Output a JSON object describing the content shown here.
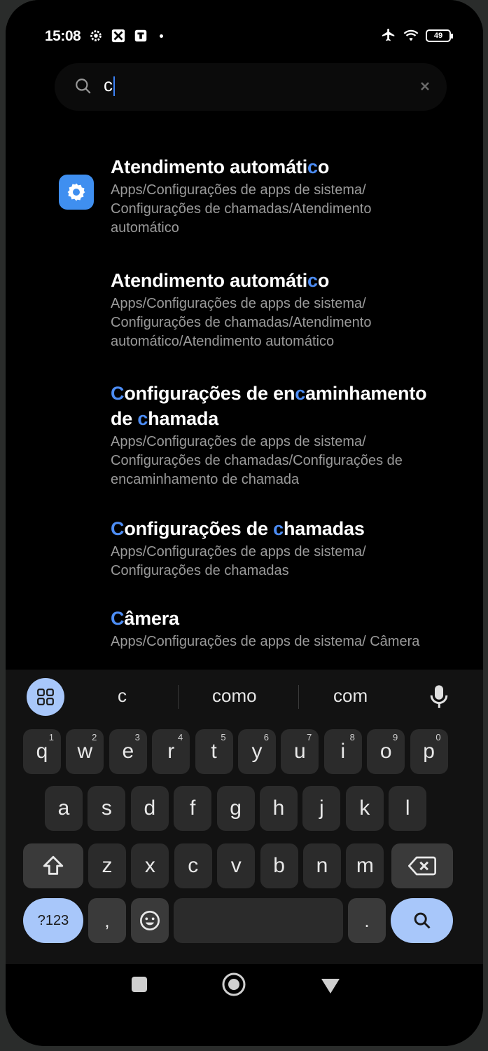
{
  "status_bar": {
    "time": "15:08",
    "battery": "49"
  },
  "search": {
    "query": "c"
  },
  "results": [
    {
      "title_parts": [
        "Atendimento automáti",
        "c",
        "o"
      ],
      "path": "Apps/Configurações de apps de sistema/ Configurações de chamadas/Atendimento automático"
    },
    {
      "title_parts": [
        "Atendimento automáti",
        "c",
        "o"
      ],
      "path": "Apps/Configurações de apps de sistema/ Configurações de chamadas/Atendimento automático/Atendimento automático"
    },
    {
      "title_parts": [
        "C",
        "onfigurações de en",
        "c",
        "aminhamento de ",
        "c",
        "hamada"
      ],
      "path": "Apps/Configurações de apps de sistema/ Configurações de chamadas/Configurações de encaminhamento de chamada"
    },
    {
      "title_parts": [
        "C",
        "onfigurações de ",
        "c",
        "hamadas"
      ],
      "path": "Apps/Configurações de apps de sistema/ Configurações de chamadas"
    },
    {
      "title_parts": [
        "C",
        "âmera"
      ],
      "path": "Apps/Configurações de apps de sistema/ Câmera"
    }
  ],
  "keyboard": {
    "suggestions": [
      "c",
      "como",
      "com"
    ],
    "row1": [
      {
        "k": "q",
        "n": "1"
      },
      {
        "k": "w",
        "n": "2"
      },
      {
        "k": "e",
        "n": "3"
      },
      {
        "k": "r",
        "n": "4"
      },
      {
        "k": "t",
        "n": "5"
      },
      {
        "k": "y",
        "n": "6"
      },
      {
        "k": "u",
        "n": "7"
      },
      {
        "k": "i",
        "n": "8"
      },
      {
        "k": "o",
        "n": "9"
      },
      {
        "k": "p",
        "n": "0"
      }
    ],
    "row2": [
      "a",
      "s",
      "d",
      "f",
      "g",
      "h",
      "j",
      "k",
      "l"
    ],
    "row3": [
      "z",
      "x",
      "c",
      "v",
      "b",
      "n",
      "m"
    ],
    "symbols_label": "?123",
    "comma_label": ",",
    "period_label": "."
  },
  "colors": {
    "highlight": "#4d8df5",
    "accent_key": "#a8c7fa",
    "settings_icon_bg": "#3f8ff0"
  },
  "icons": [
    "settings-gear-icon",
    "search-icon",
    "clear-icon",
    "mic-icon",
    "apps-grid-icon",
    "shift-icon",
    "backspace-icon",
    "emoji-icon",
    "airplane-icon",
    "wifi-icon"
  ]
}
